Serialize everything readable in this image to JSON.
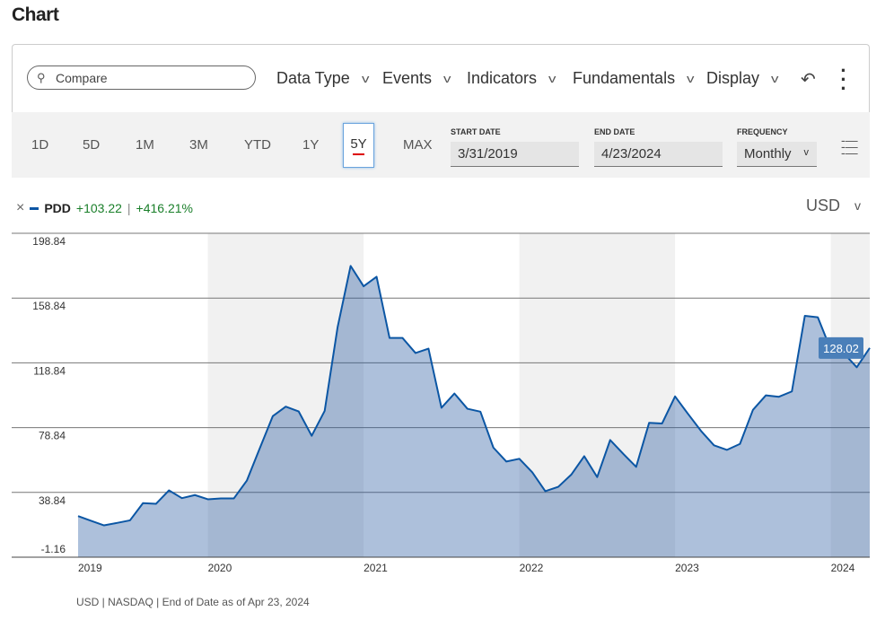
{
  "title": "Chart",
  "toolbar": {
    "search_placeholder": "Compare",
    "menus": [
      "Data Type",
      "Events",
      "Indicators",
      "Fundamentals",
      "Display"
    ],
    "icons": [
      "search-icon",
      "undo-icon",
      "more-vertical-icon"
    ]
  },
  "range": {
    "buttons": [
      "1D",
      "5D",
      "1M",
      "3M",
      "YTD",
      "1Y",
      "5Y",
      "MAX"
    ],
    "selected": "5Y",
    "start_label": "START DATE",
    "start_value": "3/31/2019",
    "end_label": "END DATE",
    "end_value": "4/23/2024",
    "freq_label": "FREQUENCY",
    "freq_value": "Monthly"
  },
  "legend": {
    "symbol": "PDD",
    "change": "+103.22",
    "sep": "|",
    "pct": "+416.21%",
    "currency": "USD"
  },
  "footer": "USD | NASDAQ | End of Date as of Apr 23, 2024",
  "colors": {
    "line": "#0b56a4",
    "area": "#a6bdd8",
    "band": "#f1f1f1",
    "positive": "#1a7f2a",
    "tooltip": "#4a7fb9"
  },
  "chart_data": {
    "type": "area",
    "title": "PDD",
    "frequency": "monthly",
    "x_start": "2019-03",
    "x_end": "2024-04",
    "xticks": [
      "2019",
      "2020",
      "2021",
      "2022",
      "2023",
      "2024"
    ],
    "yticks": [
      "198.84",
      "158.84",
      "118.84",
      "78.84",
      "38.84",
      "-1.16"
    ],
    "ylim": [
      -1.16,
      198.84
    ],
    "grid": true,
    "last_value_label": "128.02",
    "values": [
      24.2,
      21.3,
      18.5,
      20.0,
      21.6,
      32.2,
      31.8,
      40.1,
      35.3,
      37.2,
      34.6,
      35.1,
      35.1,
      46.1,
      66.1,
      85.9,
      91.8,
      88.8,
      73.8,
      89.2,
      141.0,
      178.7,
      166.1,
      172.0,
      134.2,
      134.2,
      124.9,
      127.6,
      91.1,
      99.9,
      90.5,
      88.7,
      66.5,
      57.9,
      59.6,
      51.2,
      39.6,
      42.3,
      49.8,
      61.2,
      48.3,
      71.2,
      62.7,
      54.6,
      81.8,
      81.4,
      98.1,
      87.3,
      76.8,
      67.9,
      65.1,
      68.8,
      89.8,
      98.8,
      97.9,
      101.2,
      147.9,
      147.0,
      126.9,
      124.8,
      116.1,
      128.02
    ]
  }
}
